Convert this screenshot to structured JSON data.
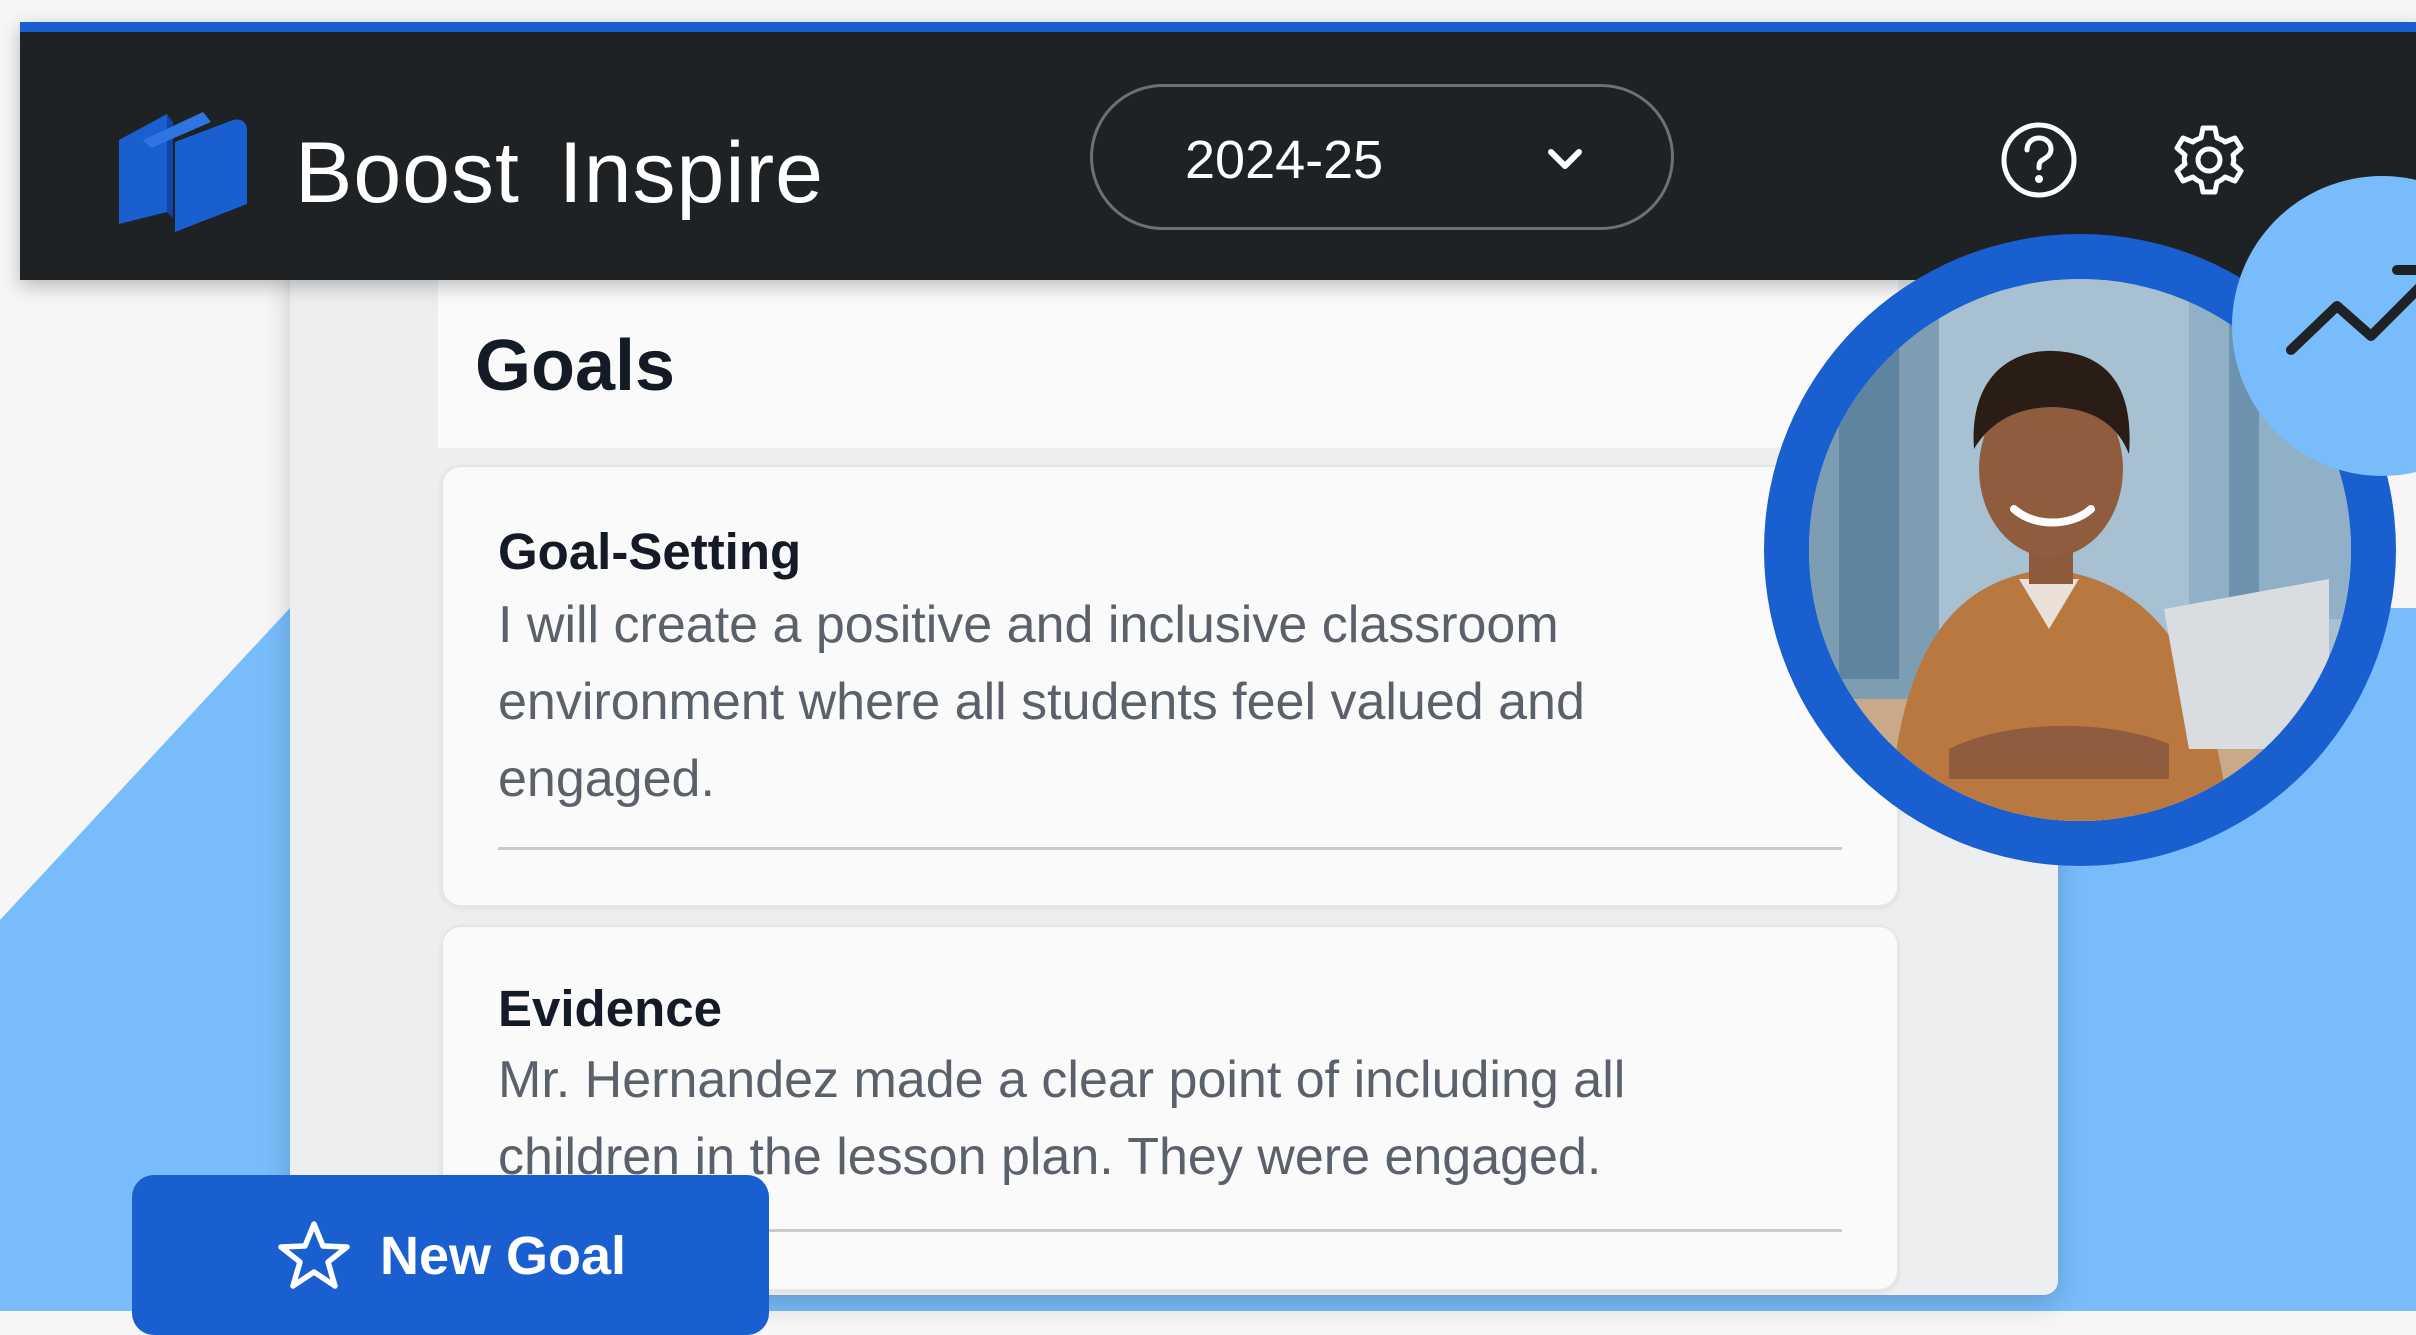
{
  "header": {
    "app_name": "Boost Inspire",
    "logo_icon": "book-icon",
    "year_select": {
      "value": "2024-25",
      "icon": "chevron-down-icon"
    },
    "help_icon": "question-circle-icon",
    "settings_icon": "gear-icon"
  },
  "main": {
    "title": "Goals",
    "cards": [
      {
        "title": "Goal-Setting",
        "body": "I will create a positive and inclusive classroom environment where all students feel valued and engaged."
      },
      {
        "title": "Evidence",
        "body": "Mr. Hernandez made a clear point of including all children in the lesson plan. They were engaged."
      }
    ]
  },
  "photo": {
    "icon": "trending-up-icon"
  },
  "actions": {
    "new_goal_label": "New Goal",
    "new_goal_icon": "star-icon"
  },
  "colors": {
    "accent_blue": "#1a5fcf",
    "light_blue": "#78bcfb",
    "header_bg": "#1f2224"
  }
}
